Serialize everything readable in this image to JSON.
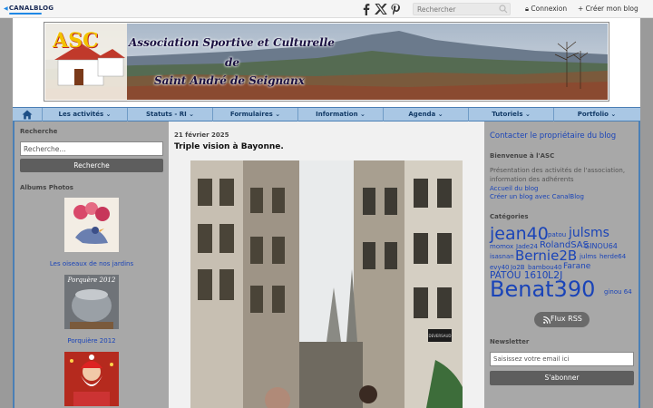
{
  "topbar": {
    "logo": "CANALBLOG",
    "search_placeholder": "Rechercher",
    "login": "Connexion",
    "create": "+  Créer mon blog"
  },
  "banner": {
    "line1": "Association Sportive et Culturelle",
    "line2": "de",
    "line3": "Saint André de Seignanx",
    "logo_text": "ASC"
  },
  "nav": {
    "items": [
      {
        "label": "Les activités"
      },
      {
        "label": "Statuts - RI"
      },
      {
        "label": "Formulaires"
      },
      {
        "label": "Information"
      },
      {
        "label": "Agenda"
      },
      {
        "label": "Tutoriels"
      },
      {
        "label": "Portfolio"
      }
    ]
  },
  "left": {
    "search_title": "Recherche",
    "search_placeholder": "Recherche...",
    "search_button": "Recherche",
    "albums_title": "Albums Photos",
    "albums": [
      {
        "caption": "Les oiseaux de nos jardins"
      },
      {
        "caption": "Porquière 2012",
        "thumb_text": "Porquère 2012"
      },
      {
        "caption": ""
      }
    ]
  },
  "post": {
    "date": "21 février 2025",
    "title": "Triple vision à Bayonne.",
    "shop_sign": "DEVERSAUD"
  },
  "right": {
    "contact": "Contacter le propriétaire du blog",
    "about_title": "Bienvenue à l'ASC",
    "about_text": "Présentation des activités de l'association, information des adhérents",
    "link_home": "Accueil du blog",
    "link_create": "Créer un blog avec CanalBlog",
    "cat_title": "Catégories",
    "tags": [
      "jean40",
      "patou",
      "julsms",
      "momox",
      "Jade24",
      "RolandSAS",
      "GINOU64",
      "isasnan",
      "Bernie2B",
      "julms",
      "herde64",
      "evy40",
      "Jo2B",
      "bambou40",
      "Farane",
      "PATOU 1610",
      "L2J",
      "Benat390",
      "ginou 64"
    ],
    "rss": "Flux RSS",
    "newsletter_title": "Newsletter",
    "newsletter_placeholder": "Saisissez votre email ici",
    "newsletter_button": "S'abonner"
  },
  "colors": {
    "nav_bg": "#a9c7e4",
    "frame": "#4a7fb5",
    "link": "#1a44b8",
    "button": "#5e5e5e"
  }
}
